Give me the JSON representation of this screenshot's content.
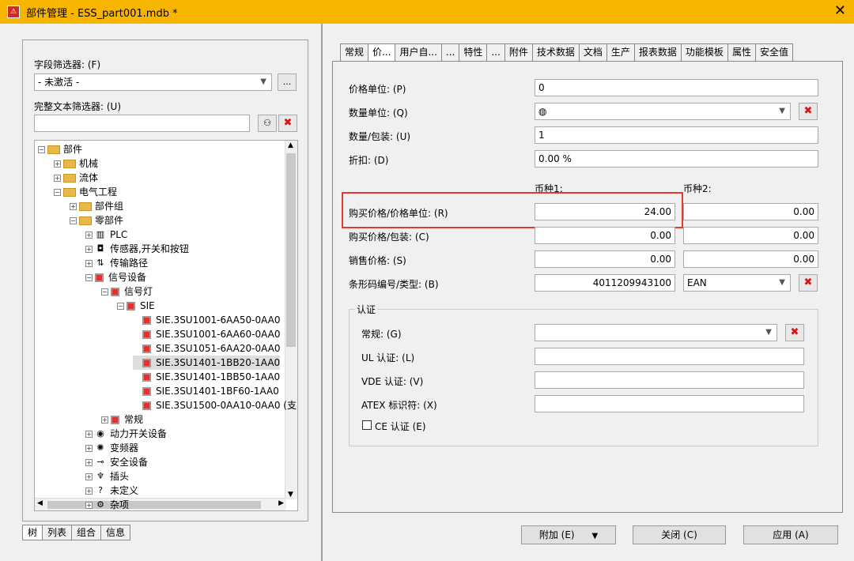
{
  "window": {
    "title": "部件管理 - ESS_part001.mdb *",
    "app_icon_glyph": "⚠"
  },
  "left": {
    "field_filter_label": "字段筛选器: (F)",
    "field_filter_value": "- 未激活 -",
    "field_filter_more": "...",
    "text_filter_label": "完整文本筛选器: (U)",
    "text_filter_value": "",
    "tree": [
      {
        "label": "部件",
        "exp": "⊟",
        "icon": "folder"
      },
      {
        "label": "机械",
        "exp": "⊞",
        "icon": "folder"
      },
      {
        "label": "流体",
        "exp": "⊞",
        "icon": "folder"
      },
      {
        "label": "电气工程",
        "exp": "⊟",
        "icon": "folder"
      },
      {
        "label": "部件组",
        "exp": "⊞",
        "icon": "folder"
      },
      {
        "label": "零部件",
        "exp": "⊟",
        "icon": "folder"
      },
      {
        "label": "PLC",
        "exp": "⊞",
        "icon": "plc"
      },
      {
        "label": "传感器,开关和按钮",
        "exp": "⊞",
        "icon": "sensor"
      },
      {
        "label": "传输路径",
        "exp": "⊞",
        "icon": "path"
      },
      {
        "label": "信号设备",
        "exp": "⊟",
        "icon": "red"
      },
      {
        "label": "信号灯",
        "exp": "⊟",
        "icon": "red"
      },
      {
        "label": "SIE",
        "exp": "⊟",
        "icon": "red"
      },
      {
        "label": "SIE.3SU1001-6AA50-0AA0",
        "exp": "",
        "icon": "red"
      },
      {
        "label": "SIE.3SU1001-6AA60-0AA0",
        "exp": "",
        "icon": "red"
      },
      {
        "label": "SIE.3SU1051-6AA20-0AA0",
        "exp": "",
        "icon": "red"
      },
      {
        "label": "SIE.3SU1401-1BB20-1AA0",
        "exp": "",
        "icon": "red"
      },
      {
        "label": "SIE.3SU1401-1BB50-1AA0",
        "exp": "",
        "icon": "red"
      },
      {
        "label": "SIE.3SU1401-1BF60-1AA0",
        "exp": "",
        "icon": "red"
      },
      {
        "label": "SIE.3SU1500-0AA10-0AA0 (支",
        "exp": "",
        "icon": "red"
      },
      {
        "label": "常规",
        "exp": "⊞",
        "icon": "red"
      },
      {
        "label": "动力开关设备",
        "exp": "⊞",
        "icon": "power"
      },
      {
        "label": "变频器",
        "exp": "⊞",
        "icon": "vfd"
      },
      {
        "label": "安全设备",
        "exp": "⊞",
        "icon": "safety"
      },
      {
        "label": "插头",
        "exp": "⊞",
        "icon": "plug"
      },
      {
        "label": "未定义",
        "exp": "⊞",
        "icon": "question"
      },
      {
        "label": "杂项",
        "exp": "⊞",
        "icon": "misc"
      }
    ],
    "bottom_tabs": [
      "树",
      "列表",
      "组合",
      "信息"
    ]
  },
  "tabs": [
    "常规",
    "价...",
    "用户自...",
    "...",
    "特性",
    "...",
    "附件",
    "技术数据",
    "文档",
    "生产",
    "报表数据",
    "功能模板",
    "属性",
    "安全值"
  ],
  "form": {
    "price_unit_label": "价格单位: (P)",
    "price_unit_value": "0",
    "qty_unit_label": "数量单位: (Q)",
    "qty_unit_value": "",
    "qty_pack_label": "数量/包装: (U)",
    "qty_pack_value": "1",
    "discount_label": "折扣: (D)",
    "discount_value": "0.00 %",
    "currency1": "币种1:",
    "currency2": "币种2:",
    "buy_price_unit_label": "购买价格/价格单位: (R)",
    "buy_price_unit_c1": "24.00",
    "buy_price_unit_c2": "0.00",
    "buy_price_pack_label": "购买价格/包装: (C)",
    "buy_price_pack_c1": "0.00",
    "buy_price_pack_c2": "0.00",
    "sell_price_label": "销售价格: (S)",
    "sell_price_c1": "0.00",
    "sell_price_c2": "0.00",
    "barcode_label": "条形码编号/类型: (B)",
    "barcode_value": "4011209943100",
    "barcode_type": "EAN",
    "cert_group": "认证",
    "cert_general_label": "常规: (G)",
    "cert_general_value": "",
    "ul_label": "UL 认证: (L)",
    "ul_value": "",
    "vde_label": "VDE 认证: (V)",
    "vde_value": "",
    "atex_label": "ATEX 标识符: (X)",
    "atex_value": "",
    "ce_label": "CE 认证 (E)"
  },
  "buttons": {
    "extra": "附加 (E)",
    "close": "关闭 (C)",
    "apply": "应用 (A)"
  }
}
